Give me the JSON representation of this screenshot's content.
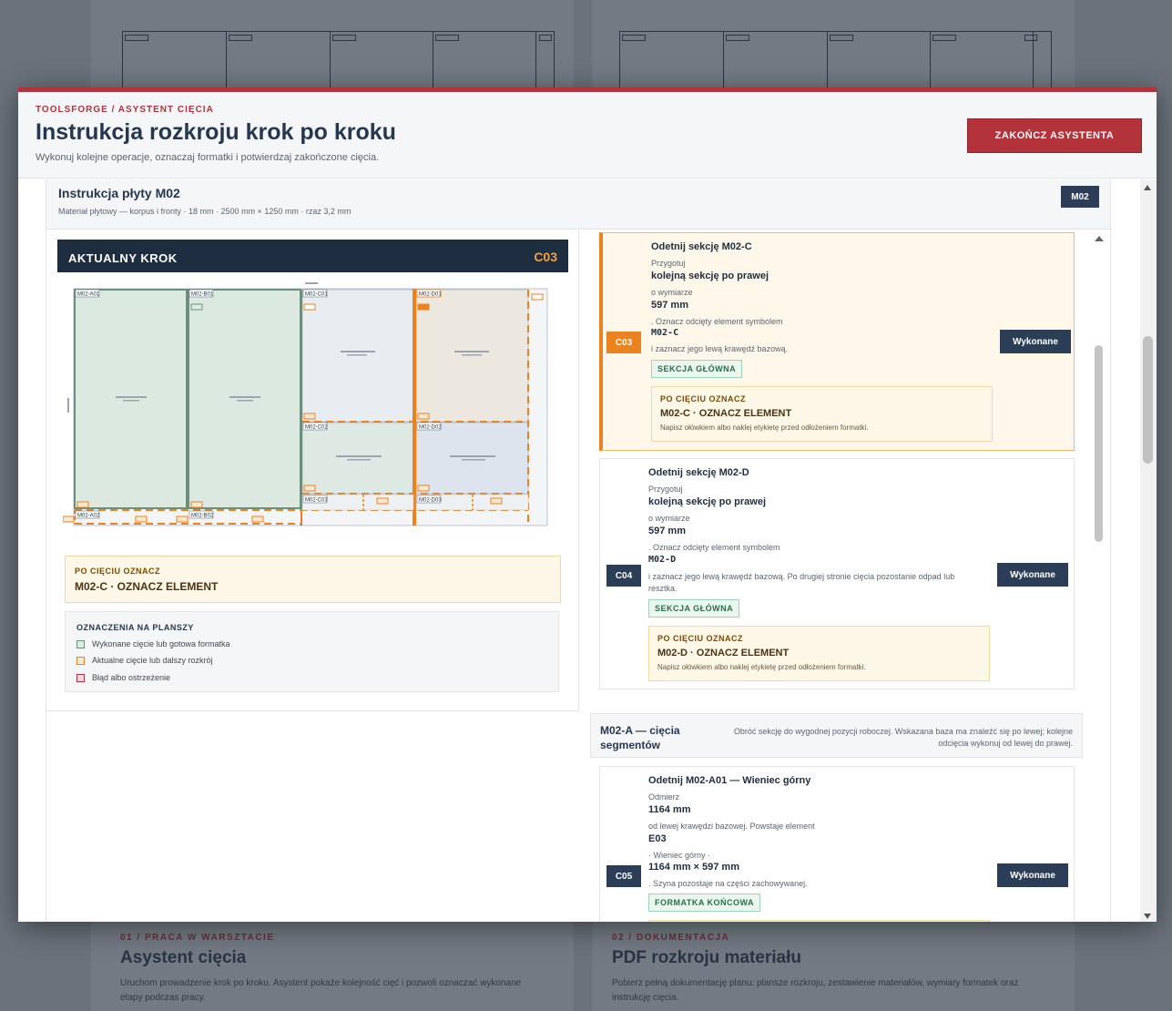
{
  "background": {
    "cards": [
      {
        "kicker": "01 / PRACA W WARSZTACIE",
        "title": "Asystent cięcia",
        "text": "Uruchom prowadzenie krok po kroku. Asystent pokaże kolejność cięć i pozwoli oznaczać wykonane etapy podczas pracy."
      },
      {
        "kicker": "02 / DOKUMENTACJA",
        "title": "PDF rozkroju materiału",
        "text": "Pobierz pełną dokumentację planu: plansze rozkroju, zestawienie materiałów, wymiary formatek oraz instrukcję cięcia."
      }
    ]
  },
  "modal": {
    "kicker": "TOOLSFORGE / ASYSTENT CIĘCIA",
    "title": "Instrukcja rozkroju krok po kroku",
    "subtitle": "Wykonuj kolejne operacje, oznaczaj formatki i potwierdzaj zakończone cięcia.",
    "finish_button": "ZAKOŃCZ ASYSTENTA"
  },
  "plate": {
    "title": "Instrukcja płyty M02",
    "meta": "Materiał płytowy — korpus i fronty · 18 mm · 2500 mm × 1250 mm · rzaz 3,2 mm",
    "badge": "M02"
  },
  "current_step": {
    "label": "AKTUALNY KROK",
    "code": "C03",
    "mark_label": "PO CIĘCIU OZNACZ",
    "mark_value": "M02-C · OZNACZ ELEMENT"
  },
  "diagram_labels": {
    "a01": "M02-A01",
    "b01": "M02-B01",
    "c01": "M02-C01",
    "d01": "M02-D01",
    "c02": "M02-C02",
    "d02": "M02-D02",
    "c03": "M02-C03",
    "d03": "M02-D03",
    "a02": "M02-A02",
    "b02": "M02-B02"
  },
  "legend": {
    "title": "OZNACZENIA NA PLANSZY",
    "items": [
      {
        "label": "Wykonane cięcie lub gotowa formatka",
        "fill": "#dbeee3",
        "border": "#6a8f7a"
      },
      {
        "label": "Aktualne cięcie lub dalszy rozkrój",
        "fill": "#fde7cf",
        "border": "#e9821f"
      },
      {
        "label": "Błąd albo ostrzeżenie",
        "fill": "#f9d9da",
        "border": "#b3333a"
      }
    ]
  },
  "steps": [
    {
      "code": "C03",
      "title": "Odetnij sekcję M02-C",
      "l1": "Przygotuj",
      "b1": "kolejną sekcję po prawej",
      "l2": "o wymiarze",
      "b2": "597 mm",
      "l3": ". Oznacz odcięty element symbolem",
      "mono": "M02-C",
      "l4": "i zaznacz jego lewą krawędź bazową.",
      "tag": "SEKCJA GŁÓWNA",
      "done": "Wykonane",
      "mark_label": "PO CIĘCIU OZNACZ",
      "mark_value": "M02-C · OZNACZ ELEMENT",
      "mark_note": "Napisz ołówkiem albo naklej etykietę przed odłożeniem formatki."
    },
    {
      "code": "C04",
      "title": "Odetnij sekcję M02-D",
      "l1": "Przygotuj",
      "b1": "kolejną sekcję po prawej",
      "l2": "o wymiarze",
      "b2": "597 mm",
      "l3": ". Oznacz odcięty element symbolem",
      "mono": "M02-D",
      "l4": "i zaznacz jego lewą krawędź bazową. Po drugiej stronie cięcia pozostanie odpad lub",
      "l4b": "resztka.",
      "tag": "SEKCJA GŁÓWNA",
      "done": "Wykonane",
      "mark_label": "PO CIĘCIU OZNACZ",
      "mark_value": "M02-D · OZNACZ ELEMENT",
      "mark_note": "Napisz ołówkiem albo naklej etykietę przed odłożeniem formatki."
    }
  ],
  "segment": {
    "title": "M02-A — cięcia segmentów",
    "desc": "Obróć sekcję do wygodnej pozycji roboczej. Wskazana baza ma znaleźć się po lewej; kolejne odcięcia wykonuj od lewej do prawej."
  },
  "step5": {
    "code": "C05",
    "title": "Odetnij M02-A01 — Wieniec górny",
    "l1": "Odmierz",
    "b1": "1164 mm",
    "l2": "od lewej krawędzi bazowej. Powstaje element",
    "b2": "E03",
    "l3": "· Wieniec górny ·",
    "b3": "1164 mm × 597 mm",
    "l4": ". Szyna pozostaje na części zachowywanej.",
    "tag": "FORMATKA KOŃCOWA",
    "done": "Wykonane"
  }
}
